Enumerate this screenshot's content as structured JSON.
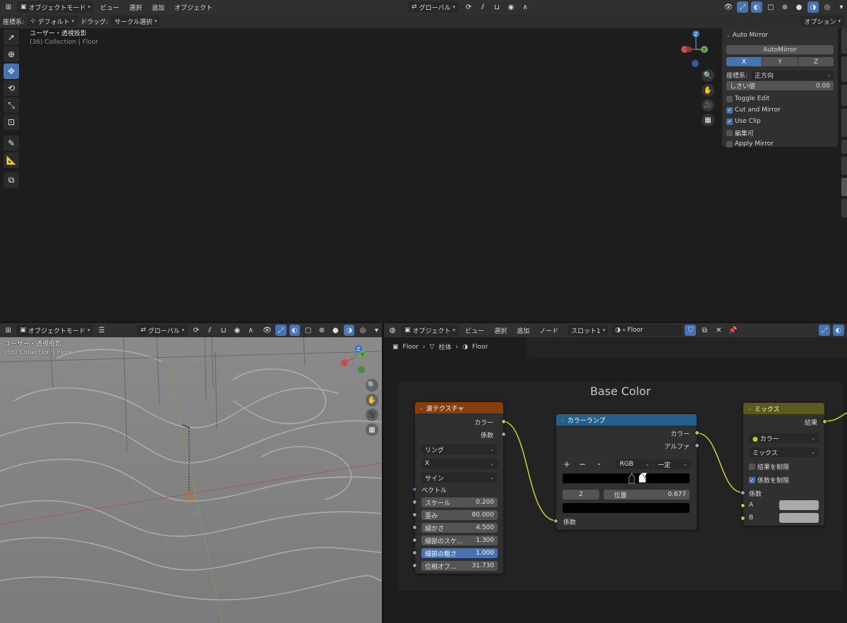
{
  "top_header": {
    "mode": "オブジェクトモード",
    "menus": [
      "ビュー",
      "選択",
      "追加",
      "オブジェクト"
    ],
    "transform": "グローバル",
    "options": "オプション"
  },
  "tool_header": {
    "orientation_label": "座標系:",
    "orientation_value": "デフォルト",
    "drag_label": "ドラッグ:",
    "drag_value": "サークル選択"
  },
  "viewport_top": {
    "view_name": "ユーザー・透視投影",
    "collection": "(36) Collection | Floor"
  },
  "auto_mirror": {
    "title": "Auto Mirror",
    "run_button": "AutoMirror",
    "axes": [
      "X",
      "Y",
      "Z"
    ],
    "orientation_label": "座標系:",
    "orientation_value": "正方向",
    "threshold_label": "しきい値",
    "threshold_value": "0.00",
    "toggle_edit": "Toggle Edit",
    "cut_and_mirror": "Cut and Mirror",
    "use_clip": "Use Clip",
    "editable": "編集可",
    "apply_mirror": "Apply Mirror"
  },
  "bottom_left_header": {
    "mode": "オブジェクトモード",
    "transform": "グローバル"
  },
  "viewport_bottom": {
    "view_name": "ユーザー・透視投影",
    "collection": "(36) Collection | Floor"
  },
  "node_header": {
    "type": "オブジェクト",
    "menus": [
      "ビュー",
      "選択",
      "追加",
      "ノード"
    ],
    "slot": "スロット1",
    "material": "Floor"
  },
  "breadcrumb": [
    "Floor",
    "柱体",
    "Floor"
  ],
  "frame_label": "Base Color",
  "wave_node": {
    "title": "波テクスチャ",
    "out_color": "カラー",
    "out_fac": "係数",
    "type": "リング",
    "axis": "X",
    "profile": "サイン",
    "vector": "ベクトル",
    "params": [
      {
        "label": "スケール",
        "value": "0.200"
      },
      {
        "label": "歪み",
        "value": "80.000"
      },
      {
        "label": "細かさ",
        "value": "4.500"
      },
      {
        "label": "細部のスケ...",
        "value": "1.300"
      },
      {
        "label": "細部の粗さ",
        "value": "1.000"
      },
      {
        "label": "位相オフ...",
        "value": "31.730"
      }
    ]
  },
  "ramp_node": {
    "title": "カラーランプ",
    "out_color": "カラー",
    "out_alpha": "アルファ",
    "add": "+",
    "remove": "−",
    "mode": "RGB",
    "interp": "一定",
    "stop_index": "2",
    "pos_label": "位置",
    "pos_value": "0.677",
    "in_fac": "係数"
  },
  "mix_node": {
    "title": "ミックス",
    "result": "結果",
    "data_type": "カラー",
    "blend": "ミックス",
    "clamp_result": "結果を制限",
    "clamp_factor": "係数を制限",
    "fac": "係数",
    "a": "A",
    "b": "B"
  },
  "colors": {
    "wave_header": "#883d0c",
    "ramp_header": "#24608a",
    "mix_header": "#5a5a1c",
    "accent": "#4772b3",
    "socket_yellow": "#c7c729",
    "socket_gray": "#a1a1a1",
    "socket_purple": "#6363c7"
  }
}
